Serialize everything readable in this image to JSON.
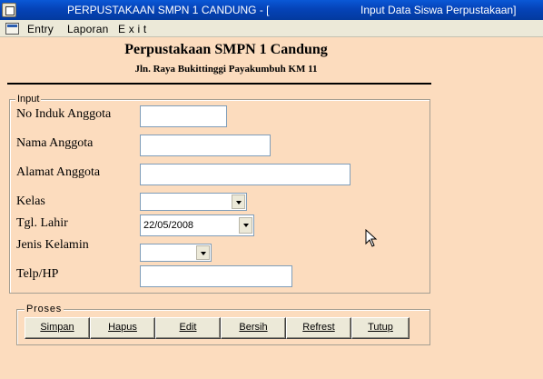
{
  "window": {
    "title_left": "PERPUSTAKAAN SMPN 1 CANDUNG - [",
    "title_right": "Input Data Siswa Perpustakaan]"
  },
  "menu": {
    "items": [
      "Entry",
      "Laporan",
      "E x i t"
    ]
  },
  "header": {
    "title": "Perpustakaan SMPN 1 Candung",
    "subtitle": "Jln. Raya Bukittinggi Payakumbuh KM 11"
  },
  "input_group": {
    "legend": "Input",
    "fields": {
      "no_induk": {
        "label": "No Induk Anggota",
        "value": ""
      },
      "nama": {
        "label": "Nama Anggota",
        "value": ""
      },
      "alamat": {
        "label": "Alamat Anggota",
        "value": ""
      },
      "kelas": {
        "label": "Kelas",
        "value": ""
      },
      "tgl_lahir": {
        "label": "Tgl. Lahir",
        "value": "22/05/2008"
      },
      "jenis_kelamin": {
        "label": "Jenis Kelamin",
        "value": ""
      },
      "telp": {
        "label": "Telp/HP",
        "value": ""
      }
    }
  },
  "proses_group": {
    "legend": "Proses",
    "buttons": [
      "Simpan",
      "Hapus",
      "Edit",
      "Bersih",
      "Refrest",
      "Tutup"
    ]
  }
}
